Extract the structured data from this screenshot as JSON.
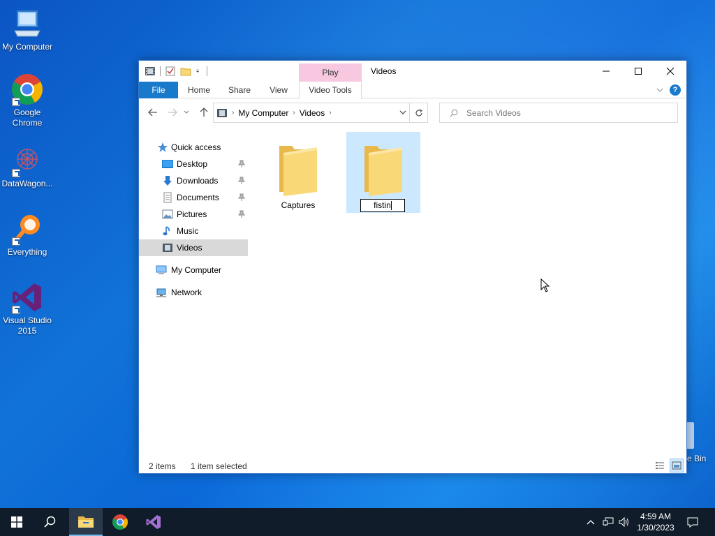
{
  "desktop": {
    "icons": [
      {
        "label": "My Computer",
        "icon": "computer-icon"
      },
      {
        "label": "Google Chrome",
        "icon": "chrome-icon"
      },
      {
        "label": "DataWagon...",
        "icon": "datawagon-icon"
      },
      {
        "label": "Everything",
        "icon": "everything-search-icon"
      },
      {
        "label": "Visual Studio 2015",
        "icon": "visual-studio-icon"
      }
    ],
    "recycle_bin_partial": "e Bin"
  },
  "window": {
    "title": "Videos",
    "contextual_tab_group": "Play",
    "ribbon_tabs": [
      "File",
      "Home",
      "Share",
      "View",
      "Video Tools"
    ],
    "address": {
      "crumbs": [
        "My Computer",
        "Videos"
      ]
    },
    "search": {
      "placeholder": "Search Videos"
    },
    "nav_pane": {
      "quick_access": "Quick access",
      "items": [
        {
          "label": "Desktop",
          "pinned": true
        },
        {
          "label": "Downloads",
          "pinned": true
        },
        {
          "label": "Documents",
          "pinned": true
        },
        {
          "label": "Pictures",
          "pinned": true
        },
        {
          "label": "Music",
          "pinned": false
        },
        {
          "label": "Videos",
          "pinned": false,
          "selected": true
        }
      ],
      "my_computer": "My Computer",
      "network": "Network"
    },
    "content": {
      "folders": [
        {
          "name": "Captures",
          "selected": false
        },
        {
          "name": "",
          "selected": true,
          "renaming": true,
          "rename_value": "fistin"
        }
      ]
    },
    "status": {
      "item_count": "2 items",
      "selection": "1 item selected"
    }
  },
  "taskbar": {
    "apps": [
      "start-icon",
      "search-icon",
      "file-explorer-icon",
      "chrome-icon",
      "visual-studio-icon"
    ],
    "active_app": "file-explorer-icon",
    "clock": {
      "time": "4:59 AM",
      "date": "1/30/2023"
    }
  },
  "colors": {
    "accent": "#1979ca",
    "selection": "#cce8ff",
    "contextual_tab": "#f7c8e0",
    "taskbar": "#101c29"
  }
}
